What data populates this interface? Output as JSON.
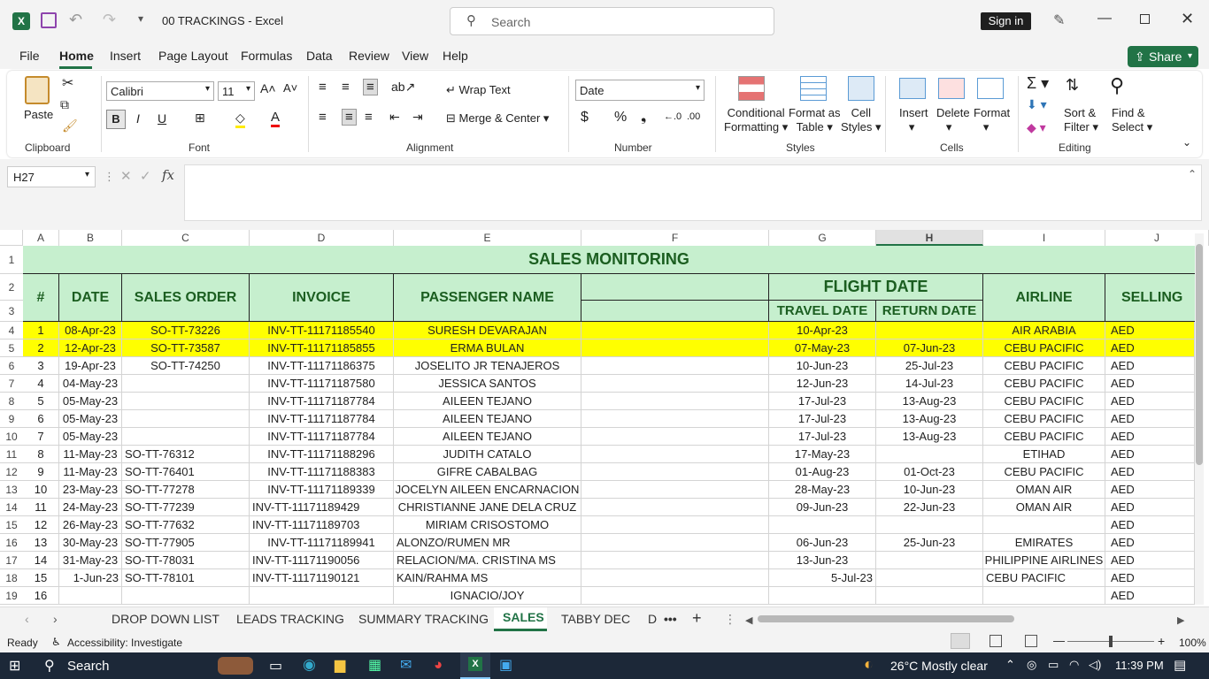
{
  "window": {
    "title": "00 TRACKINGS  -  Excel",
    "search_placeholder": "Search",
    "sign_in": "Sign in",
    "share": "Share"
  },
  "menu": [
    "File",
    "Home",
    "Insert",
    "Page Layout",
    "Formulas",
    "Data",
    "Review",
    "View",
    "Help"
  ],
  "ribbon": {
    "paste": "Paste",
    "clipboard": "Clipboard",
    "font_name": "Calibri",
    "font_size": "11",
    "font": "Font",
    "wrap_text": "Wrap Text",
    "merge_center": "Merge & Center",
    "alignment": "Alignment",
    "number_format": "Date",
    "number": "Number",
    "cond_fmt": [
      "Conditional",
      "Formatting"
    ],
    "format_table": [
      "Format as",
      "Table"
    ],
    "cell_styles": [
      "Cell",
      "Styles"
    ],
    "styles": "Styles",
    "insert": "Insert",
    "delete": "Delete",
    "format": "Format",
    "cells": "Cells",
    "sort_filter": [
      "Sort &",
      "Filter"
    ],
    "find_select": [
      "Find &",
      "Select"
    ],
    "editing": "Editing"
  },
  "name_box": "H27",
  "columns": [
    "A",
    "B",
    "C",
    "D",
    "E",
    "F",
    "G",
    "H",
    "I",
    "J"
  ],
  "sheet": {
    "title": "SALES MONITORING",
    "headers": {
      "num": "#",
      "date": "DATE",
      "sales_order": "SALES ORDER",
      "invoice": "INVOICE",
      "passenger": "PASSENGER NAME",
      "flight_date": "FLIGHT DATE",
      "travel_date": "TRAVEL DATE",
      "return_date": "RETURN DATE",
      "airline": "AIRLINE",
      "selling": "SELLING"
    },
    "rows": [
      {
        "r": "4",
        "n": "1",
        "date": "08-Apr-23",
        "so": "SO-TT-73226",
        "inv": "INV-TT-11171185540",
        "pax": "SURESH DEVARAJAN",
        "f": "",
        "tr": "10-Apr-23",
        "rt": "",
        "air": "AIR ARABIA",
        "cur": "AED",
        "hl": true
      },
      {
        "r": "5",
        "n": "2",
        "date": "12-Apr-23",
        "so": "SO-TT-73587",
        "inv": "INV-TT-11171185855",
        "pax": "ERMA BULAN",
        "f": "",
        "tr": "07-May-23",
        "rt": "07-Jun-23",
        "air": "CEBU PACIFIC",
        "cur": "AED",
        "hl": true
      },
      {
        "r": "6",
        "n": "3",
        "date": "19-Apr-23",
        "so": "SO-TT-74250",
        "inv": "INV-TT-11171186375",
        "pax": "JOSELITO JR TENAJEROS",
        "f": "",
        "tr": "10-Jun-23",
        "rt": "25-Jul-23",
        "air": "CEBU PACIFIC",
        "cur": "AED"
      },
      {
        "r": "7",
        "n": "4",
        "date": "04-May-23",
        "so": "",
        "inv": "INV-TT-11171187580",
        "pax": "JESSICA SANTOS",
        "f": "",
        "tr": "12-Jun-23",
        "rt": "14-Jul-23",
        "air": "CEBU PACIFIC",
        "cur": "AED"
      },
      {
        "r": "8",
        "n": "5",
        "date": "05-May-23",
        "so": "",
        "inv": "INV-TT-11171187784",
        "pax": "AILEEN TEJANO",
        "f": "",
        "tr": "17-Jul-23",
        "rt": "13-Aug-23",
        "air": "CEBU PACIFIC",
        "cur": "AED"
      },
      {
        "r": "9",
        "n": "6",
        "date": "05-May-23",
        "so": "",
        "inv": "INV-TT-11171187784",
        "pax": "AILEEN TEJANO",
        "f": "",
        "tr": "17-Jul-23",
        "rt": "13-Aug-23",
        "air": "CEBU PACIFIC",
        "cur": "AED"
      },
      {
        "r": "10",
        "n": "7",
        "date": "05-May-23",
        "so": "",
        "inv": "INV-TT-11171187784",
        "pax": "AILEEN TEJANO",
        "f": "",
        "tr": "17-Jul-23",
        "rt": "13-Aug-23",
        "air": "CEBU PACIFIC",
        "cur": "AED"
      },
      {
        "r": "11",
        "n": "8",
        "date": "11-May-23",
        "so": "SO-TT-76312",
        "inv": "INV-TT-11171188296",
        "pax": "JUDITH CATALO",
        "f": "",
        "tr": "17-May-23",
        "rt": "",
        "air": "ETIHAD",
        "cur": "AED",
        "soL": true
      },
      {
        "r": "12",
        "n": "9",
        "date": "11-May-23",
        "so": "SO-TT-76401",
        "inv": "INV-TT-11171188383",
        "pax": "GIFRE CABALBAG",
        "f": "",
        "tr": "01-Aug-23",
        "rt": "01-Oct-23",
        "air": "CEBU PACIFIC",
        "cur": "AED",
        "soL": true
      },
      {
        "r": "13",
        "n": "10",
        "date": "23-May-23",
        "so": "SO-TT-77278",
        "inv": "INV-TT-11171189339",
        "pax": "JOCELYN AILEEN ENCARNACION",
        "f": "",
        "tr": "28-May-23",
        "rt": "10-Jun-23",
        "air": "OMAN AIR",
        "cur": "AED",
        "soL": true
      },
      {
        "r": "14",
        "n": "11",
        "date": "24-May-23",
        "so": "SO-TT-77239",
        "inv": "INV-TT-11171189429",
        "pax": "CHRISTIANNE JANE DELA CRUZ",
        "f": "",
        "tr": "09-Jun-23",
        "rt": "22-Jun-23",
        "air": "OMAN AIR",
        "cur": "AED",
        "soL": true,
        "invL": true
      },
      {
        "r": "15",
        "n": "12",
        "date": "26-May-23",
        "so": "SO-TT-77632",
        "inv": "INV-TT-11171189703",
        "pax": "MIRIAM CRISOSTOMO",
        "f": "",
        "tr": "",
        "rt": "",
        "air": "",
        "cur": "AED",
        "soL": true,
        "invL": true
      },
      {
        "r": "16",
        "n": "13",
        "date": "30-May-23",
        "so": "SO-TT-77905",
        "inv": "INV-TT-11171189941",
        "pax": "ALONZO/RUMEN MR",
        "f": "",
        "tr": "06-Jun-23",
        "rt": "25-Jun-23",
        "air": "EMIRATES",
        "cur": "AED",
        "soL": true,
        "paxL": true
      },
      {
        "r": "17",
        "n": "14",
        "date": "31-May-23",
        "so": "SO-TT-78031",
        "inv": "INV-TT-11171190056",
        "pax": "RELACION/MA. CRISTINA MS",
        "f": "",
        "tr": "13-Jun-23",
        "rt": "",
        "air": "PHILIPPINE AIRLINES",
        "cur": "AED",
        "soL": true,
        "invL": true,
        "paxL": true
      },
      {
        "r": "18",
        "n": "15",
        "date": "1-Jun-23",
        "so": "SO-TT-78101",
        "inv": "INV-TT-11171190121",
        "pax": "KAIN/RAHMA MS",
        "f": "",
        "tr": "5-Jul-23",
        "rt": "",
        "air": "CEBU PACIFIC",
        "cur": "AED",
        "soL": true,
        "invL": true,
        "paxL": true,
        "dateR": true,
        "trR": true,
        "airL": true
      },
      {
        "r": "19",
        "n": "16",
        "date": "",
        "so": "",
        "inv": "",
        "pax": "IGNACIO/JOY",
        "f": "",
        "tr": "",
        "rt": "",
        "air": "",
        "cur": "AED"
      }
    ]
  },
  "sheet_tabs": [
    "DROP DOWN LIST",
    "LEADS TRACKING",
    "SUMMARY TRACKING",
    "SALES",
    "TABBY DEC",
    "D"
  ],
  "active_tab": "SALES",
  "status": {
    "ready": "Ready",
    "accessibility": "Accessibility: Investigate",
    "zoom": "100%"
  },
  "taskbar": {
    "search": "Search",
    "weather": "26°C  Mostly clear",
    "time": "11:39 PM"
  },
  "colors": {
    "header_green": "#c6efce",
    "header_text": "#1b5e20",
    "highlight": "#ffff00",
    "excel_green": "#217346"
  }
}
